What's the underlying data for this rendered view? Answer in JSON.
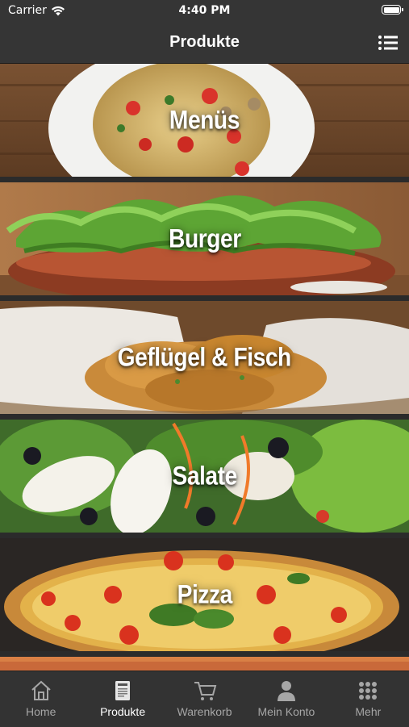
{
  "status_bar": {
    "carrier": "Carrier",
    "time": "4:40 PM"
  },
  "nav": {
    "title": "Produkte",
    "menu_icon": "list-icon"
  },
  "categories": [
    {
      "label": "Menüs",
      "image": "pasta-plate"
    },
    {
      "label": "Burger",
      "image": "burger-lettuce"
    },
    {
      "label": "Geflügel & Fisch",
      "image": "fried-chicken-basket"
    },
    {
      "label": "Salate",
      "image": "mixed-salad"
    },
    {
      "label": "Pizza",
      "image": "pizza-margherita"
    }
  ],
  "tabs": [
    {
      "label": "Home",
      "icon": "home-icon",
      "active": false
    },
    {
      "label": "Produkte",
      "icon": "menu-card-icon",
      "active": true
    },
    {
      "label": "Warenkorb",
      "icon": "cart-icon",
      "active": false
    },
    {
      "label": "Mein Konto",
      "icon": "person-icon",
      "active": false
    },
    {
      "label": "Mehr",
      "icon": "more-grid-icon",
      "active": false
    }
  ],
  "colors": {
    "bar_background": "#353535",
    "tab_inactive": "#a6a6a6",
    "tab_active": "#ffffff"
  }
}
